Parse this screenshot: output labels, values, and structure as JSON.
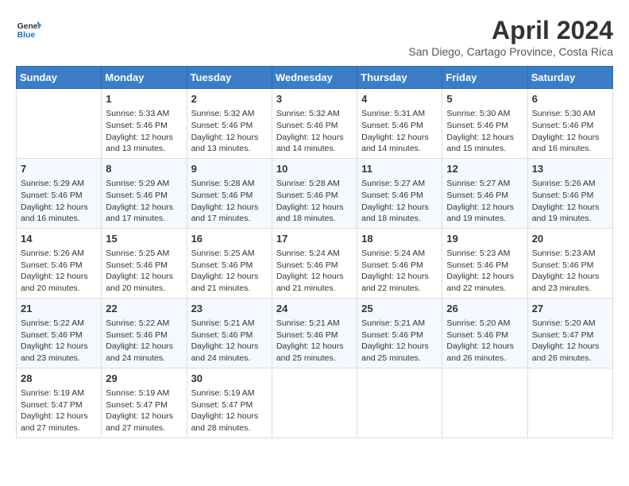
{
  "header": {
    "logo_line1": "General",
    "logo_line2": "Blue",
    "title": "April 2024",
    "subtitle": "San Diego, Cartago Province, Costa Rica"
  },
  "weekdays": [
    "Sunday",
    "Monday",
    "Tuesday",
    "Wednesday",
    "Thursday",
    "Friday",
    "Saturday"
  ],
  "weeks": [
    [
      {
        "day": "",
        "sunrise": "",
        "sunset": "",
        "daylight": ""
      },
      {
        "day": "1",
        "sunrise": "5:33 AM",
        "sunset": "5:46 PM",
        "daylight": "12 hours and 13 minutes."
      },
      {
        "day": "2",
        "sunrise": "5:32 AM",
        "sunset": "5:46 PM",
        "daylight": "12 hours and 13 minutes."
      },
      {
        "day": "3",
        "sunrise": "5:32 AM",
        "sunset": "5:46 PM",
        "daylight": "12 hours and 14 minutes."
      },
      {
        "day": "4",
        "sunrise": "5:31 AM",
        "sunset": "5:46 PM",
        "daylight": "12 hours and 14 minutes."
      },
      {
        "day": "5",
        "sunrise": "5:30 AM",
        "sunset": "5:46 PM",
        "daylight": "12 hours and 15 minutes."
      },
      {
        "day": "6",
        "sunrise": "5:30 AM",
        "sunset": "5:46 PM",
        "daylight": "12 hours and 16 minutes."
      }
    ],
    [
      {
        "day": "7",
        "sunrise": "5:29 AM",
        "sunset": "5:46 PM",
        "daylight": "12 hours and 16 minutes."
      },
      {
        "day": "8",
        "sunrise": "5:29 AM",
        "sunset": "5:46 PM",
        "daylight": "12 hours and 17 minutes."
      },
      {
        "day": "9",
        "sunrise": "5:28 AM",
        "sunset": "5:46 PM",
        "daylight": "12 hours and 17 minutes."
      },
      {
        "day": "10",
        "sunrise": "5:28 AM",
        "sunset": "5:46 PM",
        "daylight": "12 hours and 18 minutes."
      },
      {
        "day": "11",
        "sunrise": "5:27 AM",
        "sunset": "5:46 PM",
        "daylight": "12 hours and 18 minutes."
      },
      {
        "day": "12",
        "sunrise": "5:27 AM",
        "sunset": "5:46 PM",
        "daylight": "12 hours and 19 minutes."
      },
      {
        "day": "13",
        "sunrise": "5:26 AM",
        "sunset": "5:46 PM",
        "daylight": "12 hours and 19 minutes."
      }
    ],
    [
      {
        "day": "14",
        "sunrise": "5:26 AM",
        "sunset": "5:46 PM",
        "daylight": "12 hours and 20 minutes."
      },
      {
        "day": "15",
        "sunrise": "5:25 AM",
        "sunset": "5:46 PM",
        "daylight": "12 hours and 20 minutes."
      },
      {
        "day": "16",
        "sunrise": "5:25 AM",
        "sunset": "5:46 PM",
        "daylight": "12 hours and 21 minutes."
      },
      {
        "day": "17",
        "sunrise": "5:24 AM",
        "sunset": "5:46 PM",
        "daylight": "12 hours and 21 minutes."
      },
      {
        "day": "18",
        "sunrise": "5:24 AM",
        "sunset": "5:46 PM",
        "daylight": "12 hours and 22 minutes."
      },
      {
        "day": "19",
        "sunrise": "5:23 AM",
        "sunset": "5:46 PM",
        "daylight": "12 hours and 22 minutes."
      },
      {
        "day": "20",
        "sunrise": "5:23 AM",
        "sunset": "5:46 PM",
        "daylight": "12 hours and 23 minutes."
      }
    ],
    [
      {
        "day": "21",
        "sunrise": "5:22 AM",
        "sunset": "5:46 PM",
        "daylight": "12 hours and 23 minutes."
      },
      {
        "day": "22",
        "sunrise": "5:22 AM",
        "sunset": "5:46 PM",
        "daylight": "12 hours and 24 minutes."
      },
      {
        "day": "23",
        "sunrise": "5:21 AM",
        "sunset": "5:46 PM",
        "daylight": "12 hours and 24 minutes."
      },
      {
        "day": "24",
        "sunrise": "5:21 AM",
        "sunset": "5:46 PM",
        "daylight": "12 hours and 25 minutes."
      },
      {
        "day": "25",
        "sunrise": "5:21 AM",
        "sunset": "5:46 PM",
        "daylight": "12 hours and 25 minutes."
      },
      {
        "day": "26",
        "sunrise": "5:20 AM",
        "sunset": "5:46 PM",
        "daylight": "12 hours and 26 minutes."
      },
      {
        "day": "27",
        "sunrise": "5:20 AM",
        "sunset": "5:47 PM",
        "daylight": "12 hours and 26 minutes."
      }
    ],
    [
      {
        "day": "28",
        "sunrise": "5:19 AM",
        "sunset": "5:47 PM",
        "daylight": "12 hours and 27 minutes."
      },
      {
        "day": "29",
        "sunrise": "5:19 AM",
        "sunset": "5:47 PM",
        "daylight": "12 hours and 27 minutes."
      },
      {
        "day": "30",
        "sunrise": "5:19 AM",
        "sunset": "5:47 PM",
        "daylight": "12 hours and 28 minutes."
      },
      {
        "day": "",
        "sunrise": "",
        "sunset": "",
        "daylight": ""
      },
      {
        "day": "",
        "sunrise": "",
        "sunset": "",
        "daylight": ""
      },
      {
        "day": "",
        "sunrise": "",
        "sunset": "",
        "daylight": ""
      },
      {
        "day": "",
        "sunrise": "",
        "sunset": "",
        "daylight": ""
      }
    ]
  ],
  "labels": {
    "sunrise_prefix": "Sunrise: ",
    "sunset_prefix": "Sunset: ",
    "daylight_prefix": "Daylight: "
  }
}
